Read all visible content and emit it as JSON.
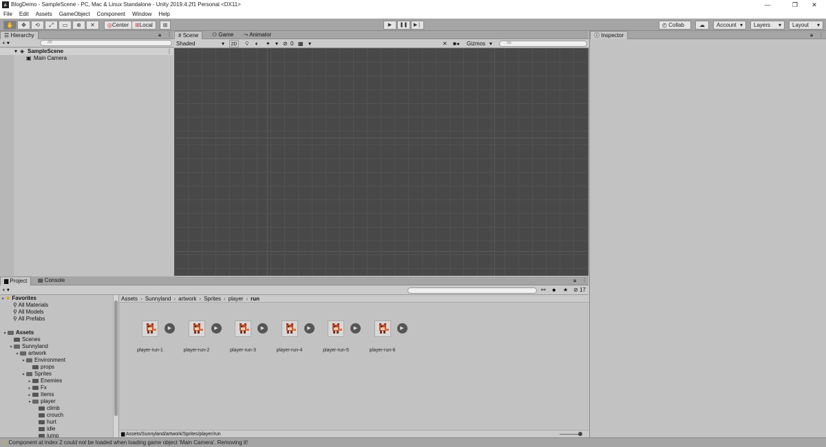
{
  "window": {
    "title": "BlogDemo - SampleScene - PC, Mac & Linux Standalone - Unity 2019.4.2f1 Personal <DX11>",
    "minimize": "—",
    "restore": "❐",
    "close": "✕"
  },
  "menu": [
    "File",
    "Edit",
    "Assets",
    "GameObject",
    "Component",
    "Window",
    "Help"
  ],
  "toolbar": {
    "pivot_label": "Center",
    "space_label": "Local",
    "collab_label": "Collab ▾",
    "account_label": "Account",
    "layers_label": "Layers",
    "layout_label": "Layout"
  },
  "hierarchy": {
    "tab_label": "Hierarchy",
    "add_label": "+ ▾",
    "search_placeholder": "All",
    "scene_name": "SampleScene",
    "objects": [
      "Main Camera"
    ]
  },
  "scene": {
    "tabs": [
      "Scene",
      "Game",
      "Animator"
    ],
    "shading_mode": "Shaded",
    "mode_2d": "2D",
    "hidden_count": "0",
    "gizmos_label": "Gizmos",
    "search_placeholder": "All"
  },
  "inspector": {
    "tab_label": "Inspector"
  },
  "project": {
    "tabs": [
      "Project",
      "Console"
    ],
    "add_label": "+ ▾",
    "hidden_count": "17",
    "breadcrumb": [
      "Assets",
      "Sunnyland",
      "artwork",
      "Sprites",
      "player",
      "run"
    ],
    "path": "Assets/Sunnyland/artwork/Sprites/player/run",
    "favorites": {
      "label": "Favorites",
      "items": [
        "All Materials",
        "All Models",
        "All Prefabs"
      ]
    },
    "tree": [
      {
        "label": "Assets",
        "depth": 0,
        "bold": true,
        "arrow": "▾"
      },
      {
        "label": "Scenes",
        "depth": 1,
        "arrow": ""
      },
      {
        "label": "Sunnyland",
        "depth": 1,
        "arrow": "▾"
      },
      {
        "label": "artwork",
        "depth": 2,
        "arrow": "▾"
      },
      {
        "label": "Environment",
        "depth": 3,
        "arrow": "▾"
      },
      {
        "label": "props",
        "depth": 4,
        "arrow": ""
      },
      {
        "label": "Sprites",
        "depth": 3,
        "arrow": "▾"
      },
      {
        "label": "Enemies",
        "depth": 4,
        "arrow": "▸"
      },
      {
        "label": "Fx",
        "depth": 4,
        "arrow": "▸"
      },
      {
        "label": "Items",
        "depth": 4,
        "arrow": "▸"
      },
      {
        "label": "player",
        "depth": 4,
        "arrow": "▾"
      },
      {
        "label": "climb",
        "depth": 5,
        "arrow": ""
      },
      {
        "label": "crouch",
        "depth": 5,
        "arrow": ""
      },
      {
        "label": "hurt",
        "depth": 5,
        "arrow": ""
      },
      {
        "label": "idle",
        "depth": 5,
        "arrow": ""
      },
      {
        "label": "jump",
        "depth": 5,
        "arrow": ""
      }
    ],
    "assets": [
      "player-run-1",
      "player-run-2",
      "player-run-3",
      "player-run-4",
      "player-run-5",
      "player-run-6"
    ]
  },
  "status": {
    "message": "Component at index 2 could not be loaded when loading game object 'Main Camera'. Removing it!"
  },
  "colors": {
    "scene_bg": "#484848",
    "panel_bg": "#c2c2c2",
    "toolbar_bg": "#a5a5a5",
    "warning": "#e0b020"
  }
}
